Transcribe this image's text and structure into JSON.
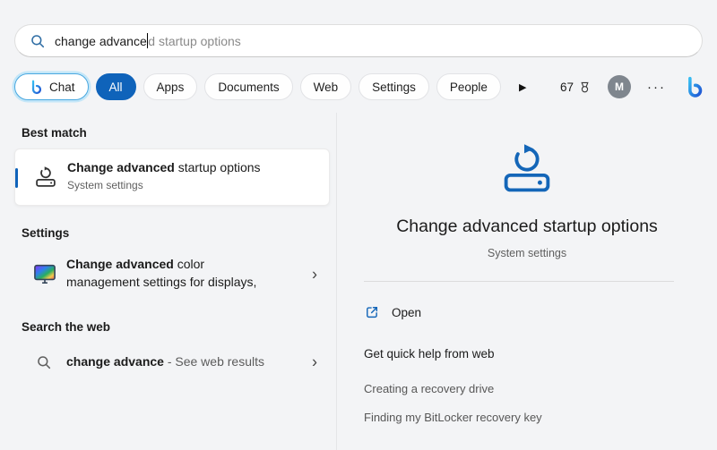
{
  "search": {
    "typed": "change advance",
    "suggestion": "d startup options"
  },
  "tabs": {
    "chat": "Chat",
    "filters": [
      "All",
      "Apps",
      "Documents",
      "Web",
      "Settings",
      "People"
    ],
    "weather_value": "67",
    "avatar_letter": "M"
  },
  "icons": {
    "chevron": "›",
    "play": "▶",
    "more": "···"
  },
  "results": {
    "best_match_header": "Best match",
    "best_match": {
      "title_bold": "Change advanced",
      "title_rest": " startup options",
      "subtitle": "System settings"
    },
    "settings_header": "Settings",
    "settings_item": {
      "bold": "Change advanced",
      "line1_rest": " color",
      "line2": "management settings for displays,"
    },
    "web_header": "Search the web",
    "web_item": {
      "bold": "change advance",
      "rest": " - See web results"
    }
  },
  "preview": {
    "title": "Change advanced startup options",
    "subtitle": "System settings",
    "open_label": "Open",
    "help_header": "Get quick help from web",
    "help_links": [
      "Creating a recovery drive",
      "Finding my BitLocker recovery key"
    ]
  },
  "colors": {
    "accent": "#0f63ba",
    "hero_icon": "#1466b8",
    "selected_tab": "#0f63ba"
  }
}
